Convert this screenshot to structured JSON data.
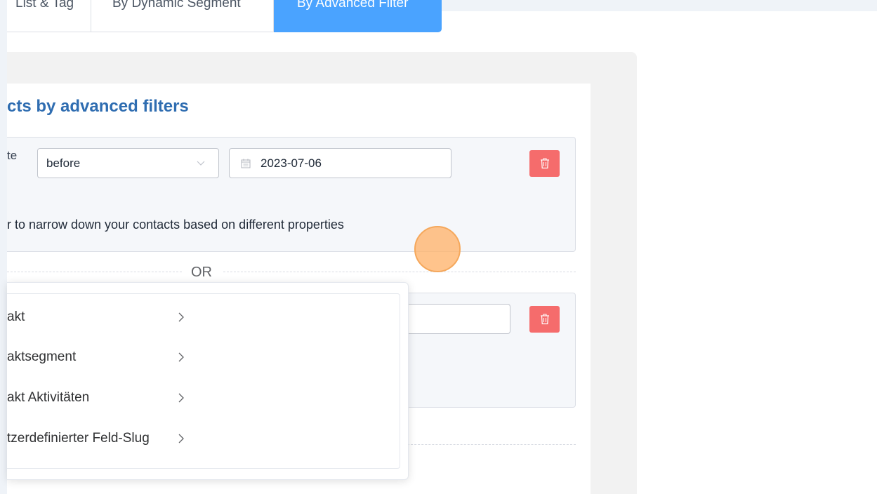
{
  "tabs": [
    {
      "label": "List & Tag",
      "active": false
    },
    {
      "label": "By Dynamic Segment",
      "active": false
    },
    {
      "label": "By Advanced Filter",
      "active": true
    }
  ],
  "heading": "cts by advanced filters",
  "filter_group_1": {
    "field_label": "te",
    "operator_value": "before",
    "date_value": "2023-07-06",
    "hint": "r to narrow down your contacts based on different properties"
  },
  "separator": "OR",
  "dropdown_menu": {
    "items": [
      {
        "label": "akt"
      },
      {
        "label": "aktsegment"
      },
      {
        "label": "akt Aktivitäten"
      },
      {
        "label": "tzerdefinierter Feld-Slug"
      }
    ]
  },
  "colors": {
    "accent_blue": "#4aa3ff",
    "heading_blue": "#2f6db1",
    "delete_red": "#f56c6c",
    "cursor_orange": "#ffb066"
  },
  "icons": [
    "calendar-icon",
    "chevron-down-icon",
    "trash-icon",
    "chevron-right-icon"
  ]
}
